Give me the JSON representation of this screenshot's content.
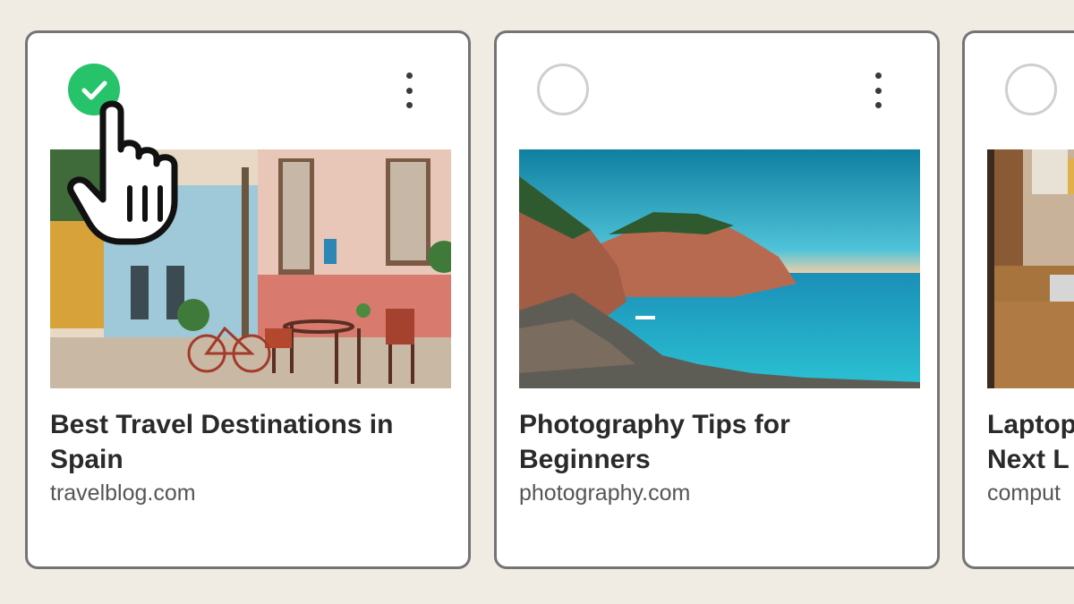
{
  "cards": [
    {
      "title": "Best Travel Destinations in Spain",
      "domain": "travelblog.com",
      "selected": true,
      "image": "spanish-street-cafe"
    },
    {
      "title": "Photography Tips for Beginners",
      "domain": "photography.com",
      "selected": false,
      "image": "coastal-cliffs-sea"
    },
    {
      "title": "Laptop Next L",
      "domain": "comput",
      "selected": false,
      "image": "laptop-desk-partial"
    }
  ],
  "colors": {
    "background": "#f1ece3",
    "card_border": "#747474",
    "selected_green": "#27c36a",
    "unselected_ring": "#cfcfcf",
    "title_text": "#2a2a2a",
    "domain_text": "#555555"
  },
  "icons": {
    "checkmark": "check-icon",
    "more": "more-vertical-icon",
    "pointer": "hand-pointer-icon"
  }
}
